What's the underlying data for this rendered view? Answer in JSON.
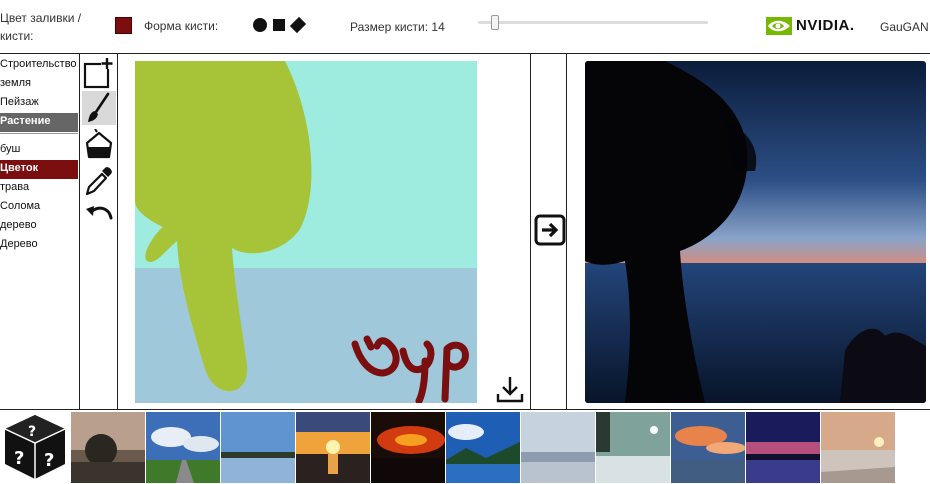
{
  "toolbar": {
    "fill_color_label": "Цвет заливки / кисти:",
    "fill_color": "#7b0e0e",
    "brush_shape_label": "Форма кисти:",
    "brush_shapes": [
      "circle-icon",
      "square-icon",
      "diamond-icon"
    ],
    "brush_size_label": "Размер кисти: 14",
    "brush_size": 14,
    "logo_text": "NVIDIA.",
    "logo_color": "#76b900",
    "app_name": "GauGAN"
  },
  "categories_top": [
    {
      "label": "Строительство",
      "selected": false
    },
    {
      "label": "земля",
      "selected": false
    },
    {
      "label": "Пейзаж",
      "selected": false
    },
    {
      "label": "Растение",
      "selected": true
    }
  ],
  "categories_bottom": [
    {
      "label": "буш",
      "selected": false
    },
    {
      "label": "Цветок",
      "selected": true
    },
    {
      "label": "трава",
      "selected": false
    },
    {
      "label": "Солома",
      "selected": false
    },
    {
      "label": "дерево",
      "selected": false
    },
    {
      "label": "Дерево",
      "selected": false
    }
  ],
  "tools": [
    "new-canvas-icon",
    "brush-icon",
    "paint-bucket-icon",
    "eyedropper-icon",
    "undo-icon"
  ],
  "canvas": {
    "sky_color": "#9eece0",
    "water_color": "#9fc9db",
    "tree_color": "#a7c337",
    "scribble_color": "#7b0e0e"
  },
  "actions": {
    "download_icon": "download-icon",
    "generate_icon": "arrow-right-icon"
  },
  "colors": {
    "selected_gray": "#666666",
    "selected_red": "#7b0e0e"
  },
  "thumbnails": [
    "dusk-trees-thumbnail",
    "road-clouds-thumbnail",
    "lake-blue-sky-thumbnail",
    "sunset-sea-thumbnail",
    "red-sunset-thumbnail",
    "blue-lake-thumbnail",
    "grey-beach-thumbnail",
    "winter-lake-thumbnail",
    "orange-clouds-thumbnail",
    "purple-sunset-thumbnail",
    "beach-sunset-thumbnail"
  ]
}
